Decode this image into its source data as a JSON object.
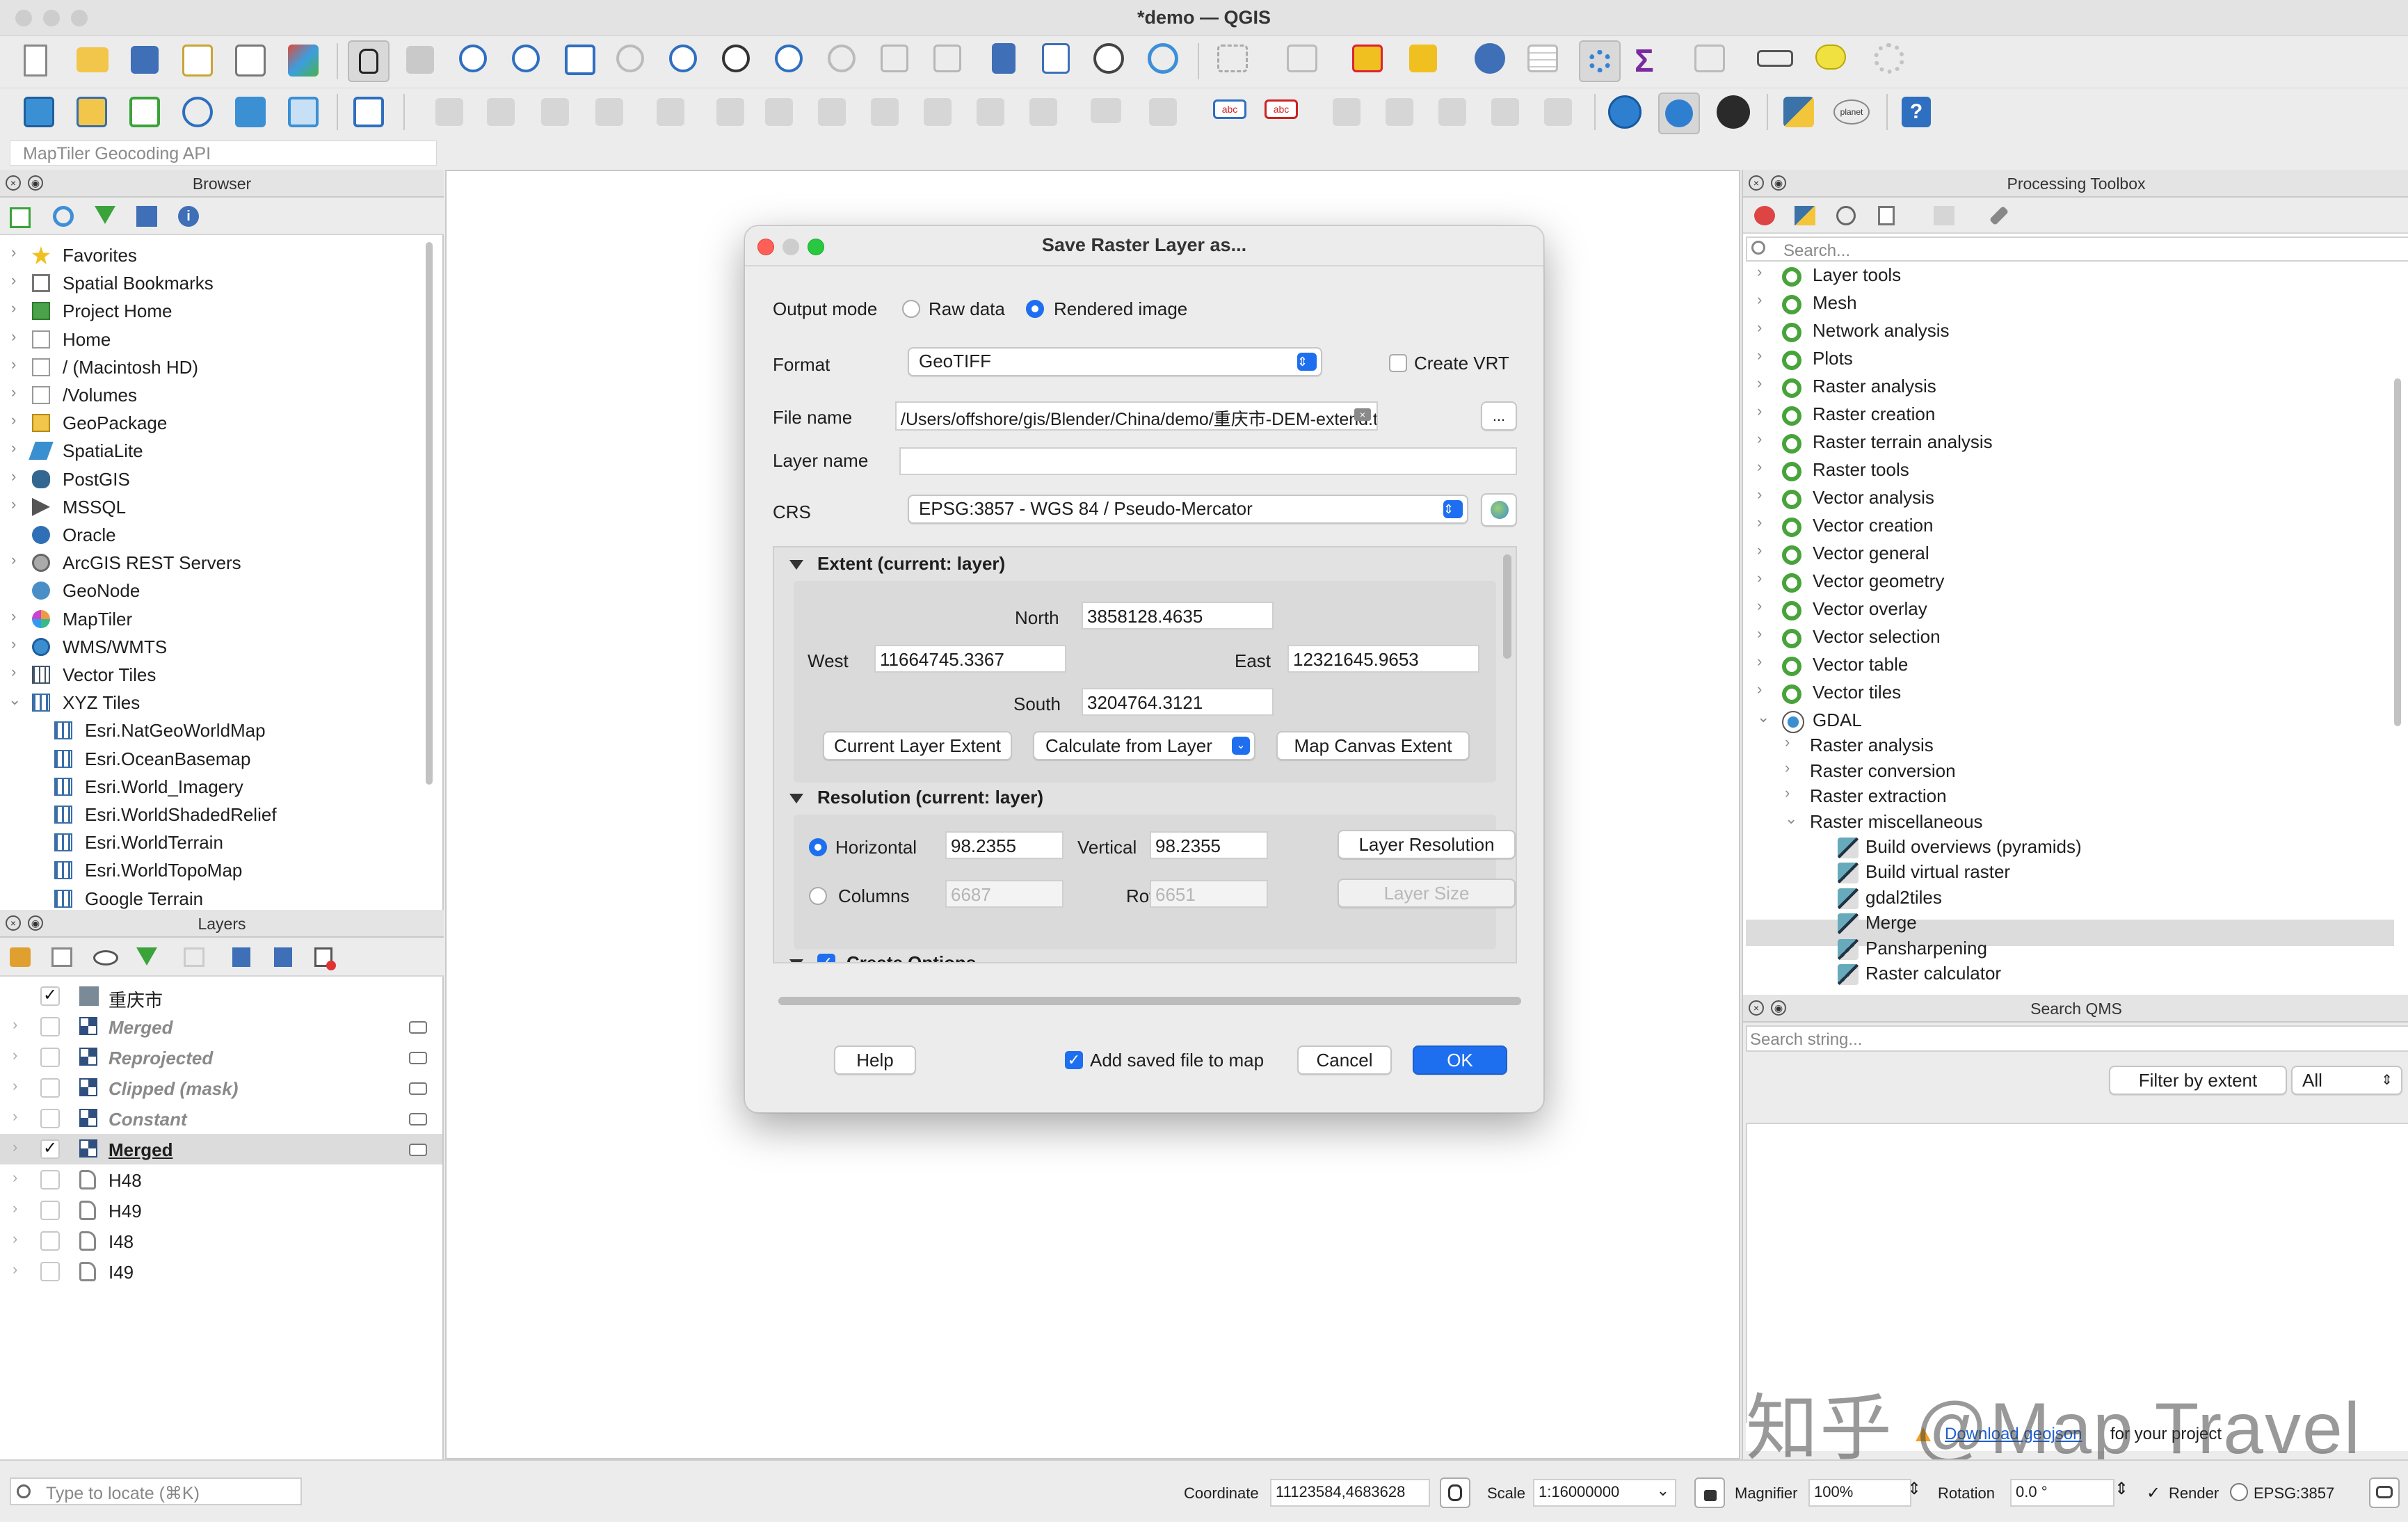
{
  "window": {
    "title": "*demo — QGIS"
  },
  "geocoder": {
    "placeholder": "MapTiler Geocoding API"
  },
  "browser": {
    "title": "Browser",
    "items": [
      {
        "label": "Favorites",
        "icon": "star-icon"
      },
      {
        "label": "Spatial Bookmarks",
        "icon": "bookmark-icon"
      },
      {
        "label": "Project Home",
        "icon": "project-home-icon"
      },
      {
        "label": "Home",
        "icon": "folder-icon"
      },
      {
        "label": "/ (Macintosh HD)",
        "icon": "folder-icon"
      },
      {
        "label": "/Volumes",
        "icon": "folder-icon"
      },
      {
        "label": "GeoPackage",
        "icon": "geopackage-icon"
      },
      {
        "label": "SpatiaLite",
        "icon": "spatialite-icon"
      },
      {
        "label": "PostGIS",
        "icon": "postgis-icon"
      },
      {
        "label": "MSSQL",
        "icon": "mssql-icon"
      },
      {
        "label": "Oracle",
        "icon": "oracle-icon"
      },
      {
        "label": "ArcGIS REST Servers",
        "icon": "arcgis-icon"
      },
      {
        "label": "GeoNode",
        "icon": "geonode-icon"
      },
      {
        "label": "MapTiler",
        "icon": "maptiler-icon"
      },
      {
        "label": "WMS/WMTS",
        "icon": "wms-icon"
      },
      {
        "label": "Vector Tiles",
        "icon": "vector-tiles-icon"
      },
      {
        "label": "XYZ Tiles",
        "icon": "xyz-tiles-icon"
      },
      {
        "label": "Esri.NatGeoWorldMap",
        "icon": "tile-grid-icon"
      },
      {
        "label": "Esri.OceanBasemap",
        "icon": "tile-grid-icon"
      },
      {
        "label": "Esri.World_Imagery",
        "icon": "tile-grid-icon"
      },
      {
        "label": "Esri.WorldShadedRelief",
        "icon": "tile-grid-icon"
      },
      {
        "label": "Esri.WorldTerrain",
        "icon": "tile-grid-icon"
      },
      {
        "label": "Esri.WorldTopoMap",
        "icon": "tile-grid-icon"
      },
      {
        "label": "Google Terrain",
        "icon": "tile-grid-icon"
      }
    ]
  },
  "layers": {
    "title": "Layers",
    "items": [
      {
        "label": "重庆市",
        "checked": true,
        "style": "group"
      },
      {
        "label": "Merged",
        "checked": false,
        "style": "italic"
      },
      {
        "label": "Reprojected",
        "checked": false,
        "style": "italic"
      },
      {
        "label": "Clipped (mask)",
        "checked": false,
        "style": "italic"
      },
      {
        "label": "Constant",
        "checked": false,
        "style": "italic"
      },
      {
        "label": "Merged",
        "checked": true,
        "style": "active"
      },
      {
        "label": "H48",
        "checked": false,
        "style": "normal"
      },
      {
        "label": "H49",
        "checked": false,
        "style": "normal"
      },
      {
        "label": "I48",
        "checked": false,
        "style": "normal"
      },
      {
        "label": "I49",
        "checked": false,
        "style": "normal"
      }
    ]
  },
  "toolbox": {
    "title": "Processing Toolbox",
    "search_placeholder": "Search...",
    "items": [
      {
        "label": "Layer tools",
        "level": 0
      },
      {
        "label": "Mesh",
        "level": 0
      },
      {
        "label": "Network analysis",
        "level": 0
      },
      {
        "label": "Plots",
        "level": 0
      },
      {
        "label": "Raster analysis",
        "level": 0
      },
      {
        "label": "Raster creation",
        "level": 0
      },
      {
        "label": "Raster terrain analysis",
        "level": 0
      },
      {
        "label": "Raster tools",
        "level": 0
      },
      {
        "label": "Vector analysis",
        "level": 0
      },
      {
        "label": "Vector creation",
        "level": 0
      },
      {
        "label": "Vector general",
        "level": 0
      },
      {
        "label": "Vector geometry",
        "level": 0
      },
      {
        "label": "Vector overlay",
        "level": 0
      },
      {
        "label": "Vector selection",
        "level": 0
      },
      {
        "label": "Vector table",
        "level": 0
      },
      {
        "label": "Vector tiles",
        "level": 0
      },
      {
        "label": "GDAL",
        "level": 0
      },
      {
        "label": "Raster analysis",
        "level": 1
      },
      {
        "label": "Raster conversion",
        "level": 1
      },
      {
        "label": "Raster extraction",
        "level": 1
      },
      {
        "label": "Raster miscellaneous",
        "level": 1
      },
      {
        "label": "Build overviews (pyramids)",
        "level": 2
      },
      {
        "label": "Build virtual raster",
        "level": 2
      },
      {
        "label": "gdal2tiles",
        "level": 2
      },
      {
        "label": "Merge",
        "level": 2
      },
      {
        "label": "Pansharpening",
        "level": 2
      },
      {
        "label": "Raster calculator",
        "level": 2
      }
    ]
  },
  "qms": {
    "title": "Search QMS",
    "placeholder": "Search string...",
    "filter_button": "Filter by extent",
    "filter_select": "All",
    "footer_link": "Download geojson",
    "footer_text": "for your project"
  },
  "watermark": "知乎 @Map Travel",
  "dialog": {
    "title": "Save Raster Layer as...",
    "output_mode_label": "Output mode",
    "raw_data": "Raw data",
    "rendered_image": "Rendered image",
    "output_mode_value": "Rendered image",
    "format_label": "Format",
    "format_value": "GeoTIFF",
    "create_vrt": "Create VRT",
    "file_name_label": "File name",
    "file_name_value": "/Users/offshore/gis/Blender/China/demo/重庆市-DEM-extend.tif",
    "browse": "...",
    "layer_name_label": "Layer name",
    "layer_name_value": "",
    "crs_label": "CRS",
    "crs_value": "EPSG:3857 - WGS 84 / Pseudo-Mercator",
    "extent_title": "Extent (current: layer)",
    "north_label": "North",
    "north": "3858128.4635",
    "west_label": "West",
    "west": "11664745.3367",
    "east_label": "East",
    "east": "12321645.9653",
    "south_label": "South",
    "south": "3204764.3121",
    "current_layer_extent": "Current Layer Extent",
    "calculate_from_layer": "Calculate from Layer",
    "map_canvas_extent": "Map Canvas Extent",
    "resolution_title": "Resolution (current: layer)",
    "horizontal_label": "Horizontal",
    "horizontal": "98.2355",
    "vertical_label": "Vertical",
    "vertical": "98.2355",
    "layer_resolution": "Layer Resolution",
    "columns_label": "Columns",
    "columns": "6687",
    "rows_label": "Rows",
    "rows": "6651",
    "layer_size": "Layer Size",
    "create_options": "Create Options",
    "help": "Help",
    "add_saved": "Add saved file to map",
    "cancel": "Cancel",
    "ok": "OK"
  },
  "status": {
    "locate_placeholder": "Type to locate (⌘K)",
    "coordinate_label": "Coordinate",
    "coordinate": "11123584,4683628",
    "scale_label": "Scale",
    "scale": "1:16000000",
    "magnifier_label": "Magnifier",
    "magnifier": "100%",
    "rotation_label": "Rotation",
    "rotation": "0.0 °",
    "render_label": "Render",
    "crs": "EPSG:3857"
  },
  "colors": {
    "accent": "#1e6ff0",
    "qgis_green": "#47a33a",
    "selection": "#dcdcdc"
  }
}
